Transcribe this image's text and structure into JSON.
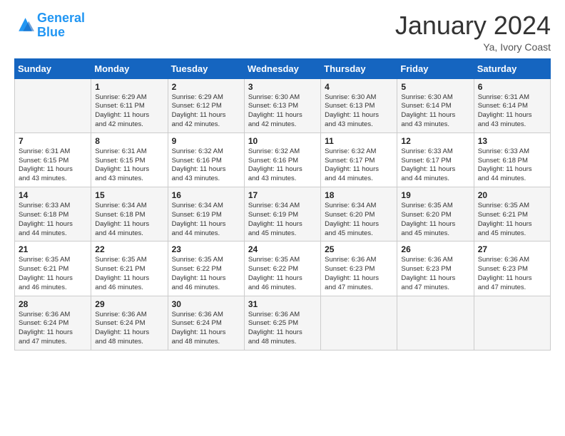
{
  "logo": {
    "line1": "General",
    "line2": "Blue"
  },
  "title": "January 2024",
  "location": "Ya, Ivory Coast",
  "header_days": [
    "Sunday",
    "Monday",
    "Tuesday",
    "Wednesday",
    "Thursday",
    "Friday",
    "Saturday"
  ],
  "weeks": [
    [
      {
        "day": "",
        "detail": ""
      },
      {
        "day": "1",
        "detail": "Sunrise: 6:29 AM\nSunset: 6:11 PM\nDaylight: 11 hours\nand 42 minutes."
      },
      {
        "day": "2",
        "detail": "Sunrise: 6:29 AM\nSunset: 6:12 PM\nDaylight: 11 hours\nand 42 minutes."
      },
      {
        "day": "3",
        "detail": "Sunrise: 6:30 AM\nSunset: 6:13 PM\nDaylight: 11 hours\nand 42 minutes."
      },
      {
        "day": "4",
        "detail": "Sunrise: 6:30 AM\nSunset: 6:13 PM\nDaylight: 11 hours\nand 43 minutes."
      },
      {
        "day": "5",
        "detail": "Sunrise: 6:30 AM\nSunset: 6:14 PM\nDaylight: 11 hours\nand 43 minutes."
      },
      {
        "day": "6",
        "detail": "Sunrise: 6:31 AM\nSunset: 6:14 PM\nDaylight: 11 hours\nand 43 minutes."
      }
    ],
    [
      {
        "day": "7",
        "detail": "Sunrise: 6:31 AM\nSunset: 6:15 PM\nDaylight: 11 hours\nand 43 minutes."
      },
      {
        "day": "8",
        "detail": "Sunrise: 6:31 AM\nSunset: 6:15 PM\nDaylight: 11 hours\nand 43 minutes."
      },
      {
        "day": "9",
        "detail": "Sunrise: 6:32 AM\nSunset: 6:16 PM\nDaylight: 11 hours\nand 43 minutes."
      },
      {
        "day": "10",
        "detail": "Sunrise: 6:32 AM\nSunset: 6:16 PM\nDaylight: 11 hours\nand 43 minutes."
      },
      {
        "day": "11",
        "detail": "Sunrise: 6:32 AM\nSunset: 6:17 PM\nDaylight: 11 hours\nand 44 minutes."
      },
      {
        "day": "12",
        "detail": "Sunrise: 6:33 AM\nSunset: 6:17 PM\nDaylight: 11 hours\nand 44 minutes."
      },
      {
        "day": "13",
        "detail": "Sunrise: 6:33 AM\nSunset: 6:18 PM\nDaylight: 11 hours\nand 44 minutes."
      }
    ],
    [
      {
        "day": "14",
        "detail": "Sunrise: 6:33 AM\nSunset: 6:18 PM\nDaylight: 11 hours\nand 44 minutes."
      },
      {
        "day": "15",
        "detail": "Sunrise: 6:34 AM\nSunset: 6:18 PM\nDaylight: 11 hours\nand 44 minutes."
      },
      {
        "day": "16",
        "detail": "Sunrise: 6:34 AM\nSunset: 6:19 PM\nDaylight: 11 hours\nand 44 minutes."
      },
      {
        "day": "17",
        "detail": "Sunrise: 6:34 AM\nSunset: 6:19 PM\nDaylight: 11 hours\nand 45 minutes."
      },
      {
        "day": "18",
        "detail": "Sunrise: 6:34 AM\nSunset: 6:20 PM\nDaylight: 11 hours\nand 45 minutes."
      },
      {
        "day": "19",
        "detail": "Sunrise: 6:35 AM\nSunset: 6:20 PM\nDaylight: 11 hours\nand 45 minutes."
      },
      {
        "day": "20",
        "detail": "Sunrise: 6:35 AM\nSunset: 6:21 PM\nDaylight: 11 hours\nand 45 minutes."
      }
    ],
    [
      {
        "day": "21",
        "detail": "Sunrise: 6:35 AM\nSunset: 6:21 PM\nDaylight: 11 hours\nand 46 minutes."
      },
      {
        "day": "22",
        "detail": "Sunrise: 6:35 AM\nSunset: 6:21 PM\nDaylight: 11 hours\nand 46 minutes."
      },
      {
        "day": "23",
        "detail": "Sunrise: 6:35 AM\nSunset: 6:22 PM\nDaylight: 11 hours\nand 46 minutes."
      },
      {
        "day": "24",
        "detail": "Sunrise: 6:35 AM\nSunset: 6:22 PM\nDaylight: 11 hours\nand 46 minutes."
      },
      {
        "day": "25",
        "detail": "Sunrise: 6:36 AM\nSunset: 6:23 PM\nDaylight: 11 hours\nand 47 minutes."
      },
      {
        "day": "26",
        "detail": "Sunrise: 6:36 AM\nSunset: 6:23 PM\nDaylight: 11 hours\nand 47 minutes."
      },
      {
        "day": "27",
        "detail": "Sunrise: 6:36 AM\nSunset: 6:23 PM\nDaylight: 11 hours\nand 47 minutes."
      }
    ],
    [
      {
        "day": "28",
        "detail": "Sunrise: 6:36 AM\nSunset: 6:24 PM\nDaylight: 11 hours\nand 47 minutes."
      },
      {
        "day": "29",
        "detail": "Sunrise: 6:36 AM\nSunset: 6:24 PM\nDaylight: 11 hours\nand 48 minutes."
      },
      {
        "day": "30",
        "detail": "Sunrise: 6:36 AM\nSunset: 6:24 PM\nDaylight: 11 hours\nand 48 minutes."
      },
      {
        "day": "31",
        "detail": "Sunrise: 6:36 AM\nSunset: 6:25 PM\nDaylight: 11 hours\nand 48 minutes."
      },
      {
        "day": "",
        "detail": ""
      },
      {
        "day": "",
        "detail": ""
      },
      {
        "day": "",
        "detail": ""
      }
    ]
  ]
}
